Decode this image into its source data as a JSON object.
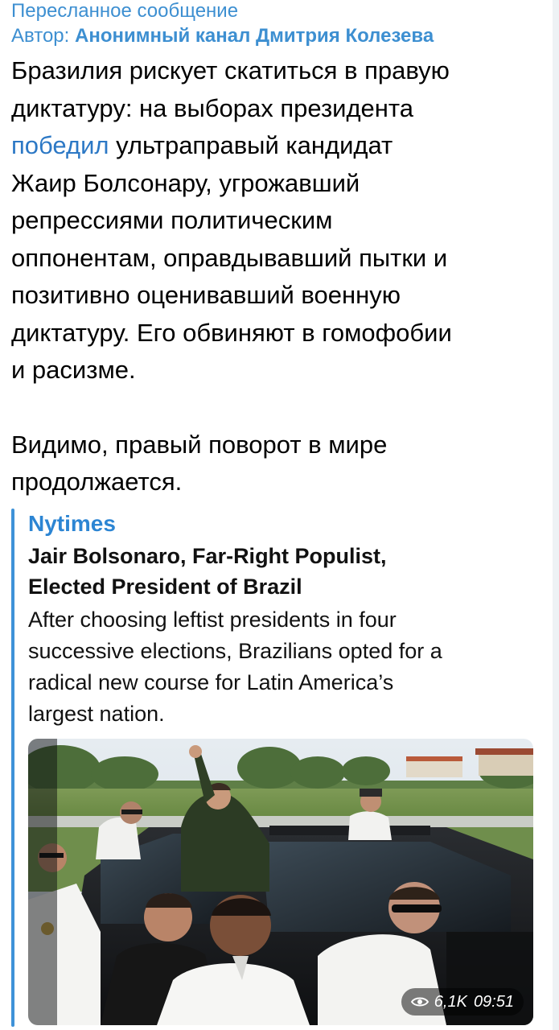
{
  "forward": {
    "label": "Пересланное сообщение",
    "author_prefix": "Автор: ",
    "author_name": "Анонимный канал Дмитрия Колезева"
  },
  "message": {
    "line_1": "Бразилия рискует скатиться в правую",
    "line_2": "диктатуру: на выборах президента",
    "link_text": "победил",
    "line_3_rest": " ультраправый кандидат",
    "line_4": "Жаир Болсонару, угрожавший",
    "line_5": "репрессиями политическим",
    "line_6": "оппонентам, оправдывавший пытки и",
    "line_7": "позитивно оценивавший военную",
    "line_8": "диктатуру. Его обвиняют в гомофобии",
    "line_9": "и расизме.",
    "line_10": "Видимо, правый поворот в мире",
    "line_11": "продолжается."
  },
  "preview": {
    "site": "Nytimes",
    "title_line_1": "Jair Bolsonaro, Far-Right Populist,",
    "title_line_2": "Elected President of Brazil",
    "desc_line_1": "After choosing leftist presidents in four",
    "desc_line_2": "successive elections, Brazilians opted for a",
    "desc_line_3": "radical new course for Latin America’s",
    "desc_line_4": "largest nation.",
    "image_icon": "news-photo"
  },
  "meta": {
    "views": "6,1K",
    "time": "09:51",
    "views_icon": "eye-icon"
  },
  "colors": {
    "accent": "#3d8fd1",
    "link": "#2c78c5",
    "preview_bar": "#3e92d8"
  }
}
